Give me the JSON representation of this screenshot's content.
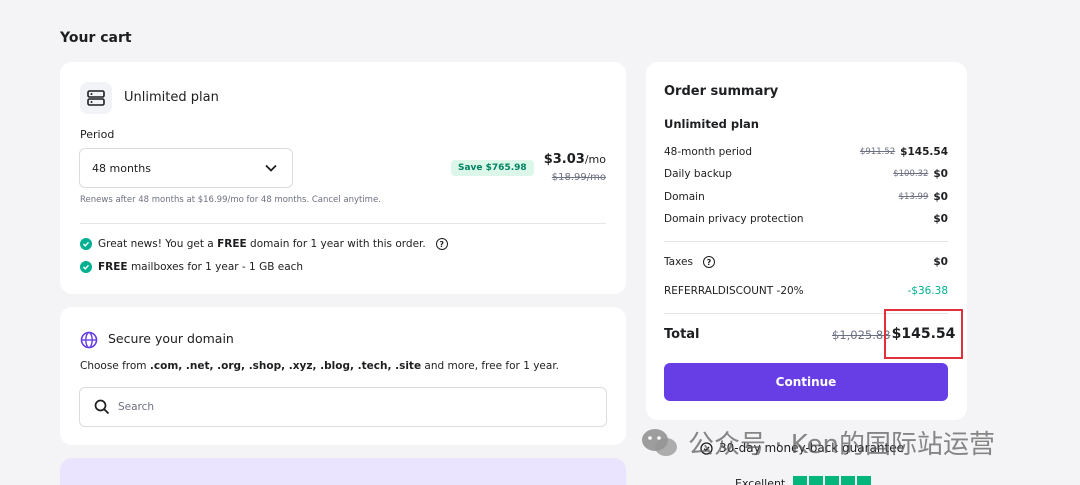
{
  "page": {
    "title": "Your cart"
  },
  "plan": {
    "name": "Unlimited plan",
    "period_label": "Period",
    "period_value": "48 months",
    "save_badge": "Save $765.98",
    "price": "$3.03",
    "price_unit": "/mo",
    "old_price": "$18.99/mo",
    "renews": "Renews after 48 months at $16.99/mo for 48 months. Cancel anytime.",
    "perk1_pre": "Great news! You get a ",
    "perk1_bold": "FREE",
    "perk1_post": " domain for 1 year with this order.",
    "perk2_bold": "FREE",
    "perk2_post": " mailboxes for 1 year - 1 GB each"
  },
  "domain": {
    "title": "Secure your domain",
    "desc_pre": "Choose from ",
    "tlds": ".com, .net, .org, .shop, .xyz, .blog, .tech, .site",
    "desc_post": " and more, free for 1 year.",
    "search_placeholder": "Search"
  },
  "summary": {
    "title": "Order summary",
    "plan": "Unlimited plan",
    "rows": [
      {
        "label": "48-month period",
        "old": "$911.52",
        "value": "$145.54"
      },
      {
        "label": "Daily backup",
        "old": "$100.32",
        "value": "$0"
      },
      {
        "label": "Domain",
        "old": "$13.99",
        "value": "$0"
      },
      {
        "label": "Domain privacy protection",
        "old": "",
        "value": "$0"
      }
    ],
    "taxes_label": "Taxes",
    "taxes_value": "$0",
    "discount_label": "REFERRALDISCOUNT -20%",
    "discount_value": "-$36.38",
    "total_label": "Total",
    "total_old": "$1,025.83",
    "total_value": "$145.54",
    "continue_label": "Continue"
  },
  "footer": {
    "moneyback": "30-day money-back guarantee",
    "rating_label": "Excellent"
  },
  "watermark": {
    "text": "公众号 · Ken的国际站运营"
  },
  "colors": {
    "accent": "#673de6",
    "success": "#00b090",
    "highlight": "#e0303a"
  }
}
